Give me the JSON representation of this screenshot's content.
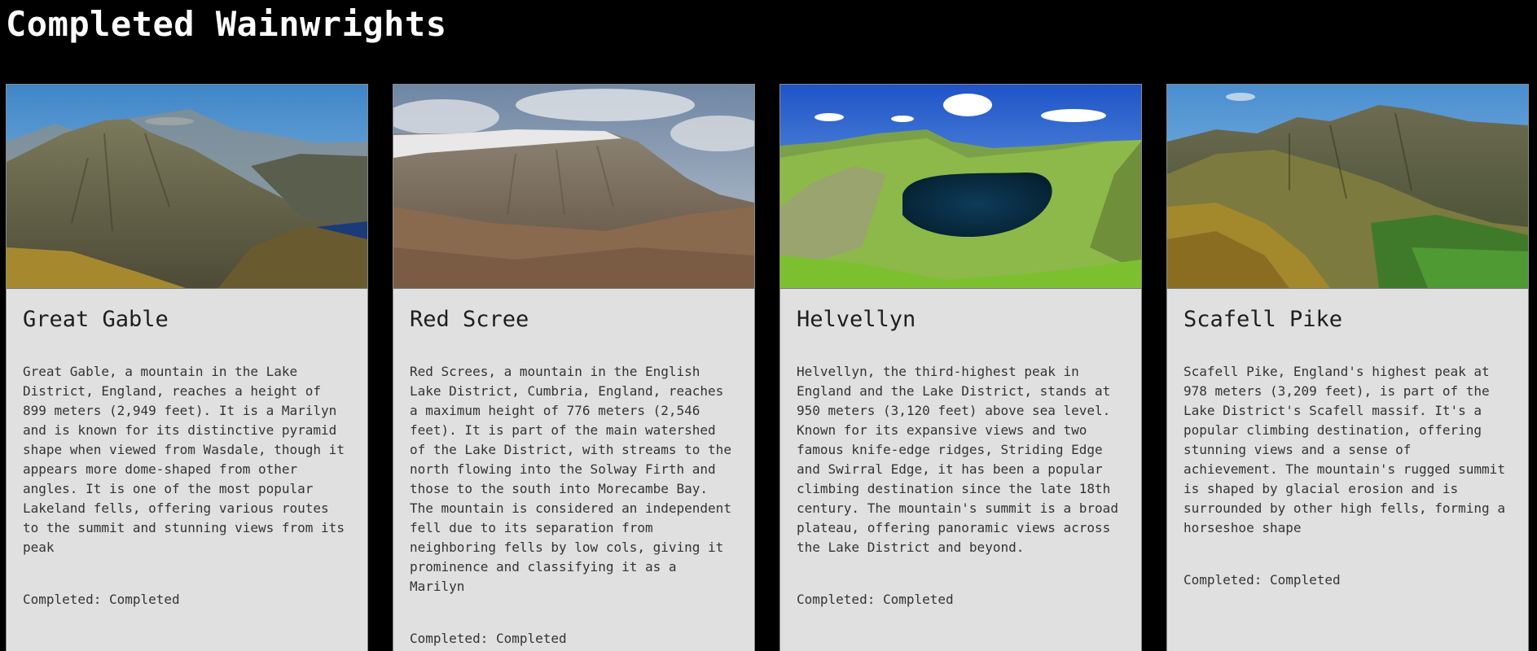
{
  "page": {
    "title": "Completed Wainwrights"
  },
  "cards": [
    {
      "name": "Great Gable",
      "description": "Great Gable, a mountain in the Lake District, England, reaches a height of 899 meters (2,949 feet). It is a Marilyn and is known for its distinctive pyramid shape when viewed from Wasdale, though it appears more dome-shaped from other angles. It is one of the most popular Lakeland fells, offering various routes to the summit and stunning views from its peak",
      "completed_label": "Completed:",
      "completed_value": "Completed"
    },
    {
      "name": "Red Scree",
      "description": "Red Screes, a mountain in the English Lake District, Cumbria, England, reaches a maximum height of 776 meters (2,546 feet). It is part of the main watershed of the Lake District, with streams to the north flowing into the Solway Firth and those to the south into Morecambe Bay. The mountain is considered an independent fell due to its separation from neighboring fells by low cols, giving it prominence and classifying it as a Marilyn",
      "completed_label": "Completed:",
      "completed_value": "Completed"
    },
    {
      "name": "Helvellyn",
      "description": "Helvellyn, the third-highest peak in England and the Lake District, stands at 950 meters (3,120 feet) above sea level. Known for its expansive views and two famous knife-edge ridges, Striding Edge and Swirral Edge, it has been a popular climbing destination since the late 18th century. The mountain's summit is a broad plateau, offering panoramic views across the Lake District and beyond.",
      "completed_label": "Completed:",
      "completed_value": "Completed"
    },
    {
      "name": "Scafell Pike",
      "description": "Scafell Pike, England's highest peak at 978 meters (3,209 feet), is part of the Lake District's Scafell massif. It's a popular climbing destination, offering stunning views and a sense of achievement. The mountain's rugged summit is shaped by glacial erosion and is surrounded by other high fells, forming a horseshoe shape",
      "completed_label": "Completed:",
      "completed_value": "Completed"
    }
  ]
}
